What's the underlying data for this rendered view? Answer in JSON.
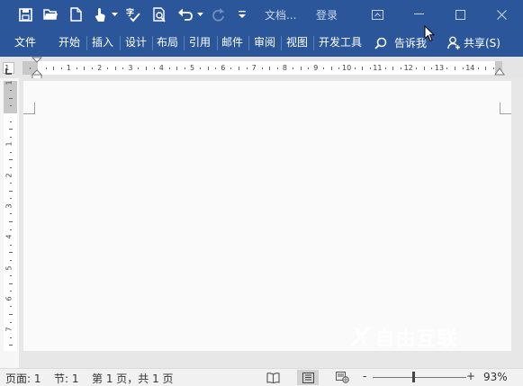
{
  "title_bar": {
    "doc_title": "文档...",
    "login_label": "登录"
  },
  "ribbon": {
    "tabs": [
      "文件",
      "开始",
      "插入",
      "设计",
      "布局",
      "引用",
      "邮件",
      "审阅",
      "视图",
      "开发工具"
    ],
    "tell_me": "告诉我",
    "share": "共享(S)"
  },
  "rulers": {
    "horizontal_numbers": [
      "1",
      "1",
      "2",
      "3",
      "4",
      "5",
      "6",
      "7",
      "8",
      "9",
      "10",
      "11",
      "12",
      "13",
      "14"
    ],
    "vertical_numbers": [
      "1",
      "1",
      "2",
      "3",
      "4",
      "5",
      "6",
      "7"
    ]
  },
  "status_bar": {
    "page": "页面: 1",
    "section": "节: 1",
    "page_count": "第 1 页，共 1 页",
    "zoom_minus": "-",
    "zoom_plus": "+",
    "zoom_level": "93%"
  },
  "watermark": "自由互联",
  "colors": {
    "ribbon_blue": "#2b579a",
    "page": "#fafafa",
    "canvas": "#e7e7e7"
  }
}
